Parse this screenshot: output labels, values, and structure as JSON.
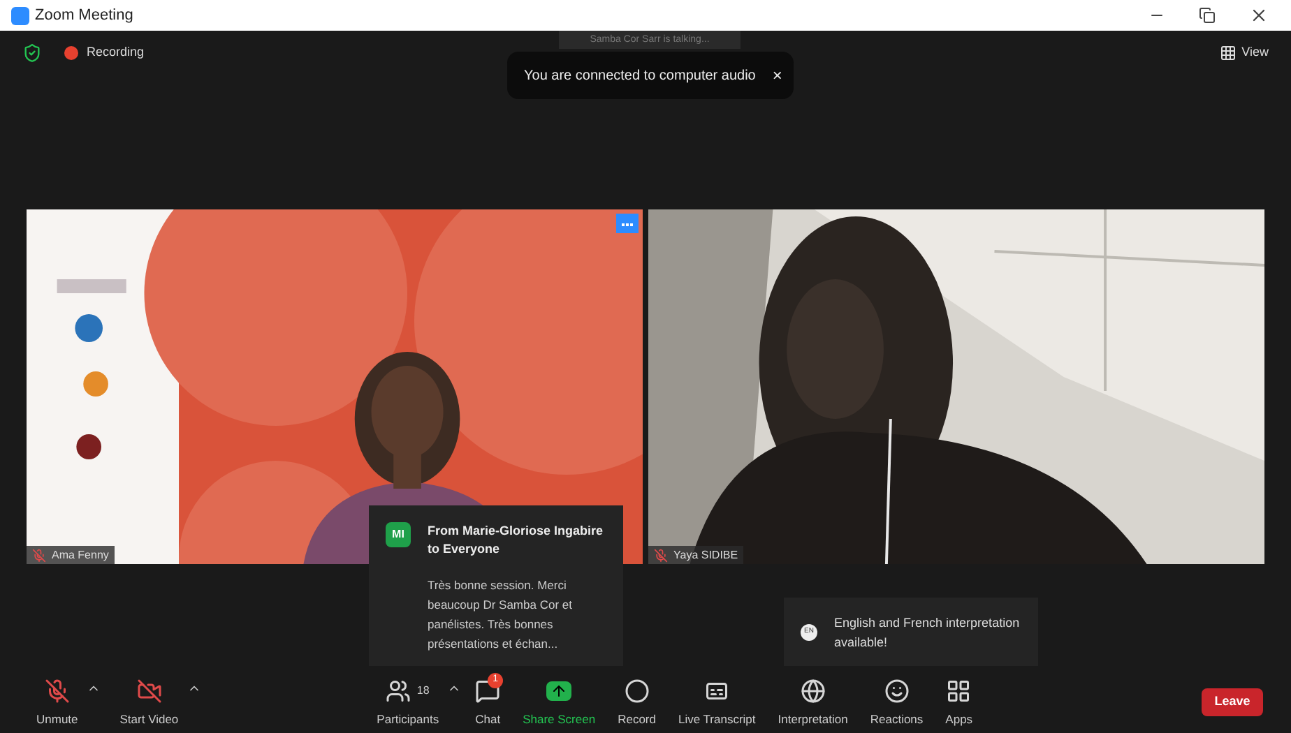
{
  "window": {
    "title": "Zoom Meeting"
  },
  "top_bar": {
    "recording_label": "Recording",
    "view_label": "View",
    "talking_label": "Samba Cor Sarr is talking..."
  },
  "audio_toast": {
    "text": "You are connected to computer audio",
    "close": "×"
  },
  "tiles": [
    {
      "name": "Ama Fenny",
      "muted": true,
      "kind": "picture",
      "menu_button": true
    },
    {
      "name": "Yaya SIDIBE",
      "muted": true,
      "kind": "picture",
      "menu_button": false
    }
  ],
  "chat_toast": {
    "initials": "MI",
    "title": "From Marie-Gloriose Ingabire to Everyone",
    "message": "Très bonne session. Merci beaucoup Dr Samba Cor et panélistes. Très bonnes présentations et échan..."
  },
  "interpretation_toast": {
    "badge": "EN",
    "text": "English and French interpretation available!"
  },
  "toolbar": [
    {
      "kind": "mic",
      "label": "Unmute",
      "off": true,
      "has_menu": true
    },
    {
      "kind": "video",
      "label": "Start Video",
      "off": true,
      "has_menu": true
    },
    {
      "kind": "participants",
      "label": "Participants",
      "count": "18",
      "has_menu": true
    },
    {
      "kind": "chat",
      "label": "Chat",
      "badge": "1",
      "has_menu": false
    },
    {
      "kind": "share",
      "label": "Share Screen",
      "has_menu": false
    },
    {
      "kind": "record",
      "label": "Record",
      "has_menu": false
    },
    {
      "kind": "transcript",
      "label": "Live Transcript",
      "has_menu": false
    },
    {
      "kind": "interpretation",
      "label": "Interpretation",
      "has_menu": false
    },
    {
      "kind": "reactions",
      "label": "Reactions",
      "has_menu": false
    },
    {
      "kind": "apps",
      "label": "Apps",
      "has_menu": false
    }
  ],
  "leave_button": "Leave"
}
